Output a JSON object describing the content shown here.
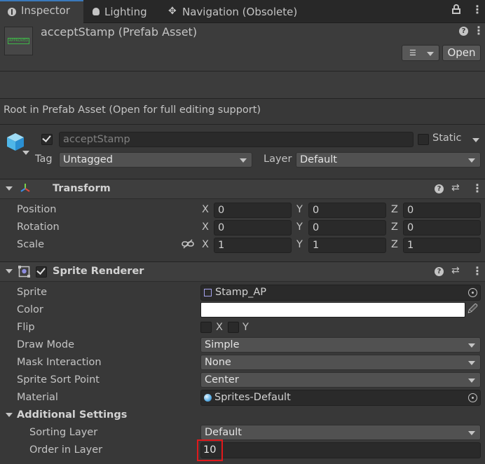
{
  "tabs": [
    {
      "label": "Inspector",
      "icon": "info-icon"
    },
    {
      "label": "Lighting",
      "icon": "bulb-icon"
    },
    {
      "label": "Navigation (Obsolete)",
      "icon": "navigation-icon"
    }
  ],
  "header": {
    "title": "acceptStamp (Prefab Asset)",
    "thumbnail_text": "APPROVED",
    "open_label": "Open"
  },
  "prefab_note": "Root in Prefab Asset (Open for full editing support)",
  "gameobject": {
    "name": "acceptStamp",
    "active": true,
    "static_label": "Static",
    "static": false,
    "tag_label": "Tag",
    "tag_value": "Untagged",
    "layer_label": "Layer",
    "layer_value": "Default"
  },
  "transform": {
    "title": "Transform",
    "rows": [
      {
        "label": "Position",
        "x": "0",
        "y": "0",
        "z": "0"
      },
      {
        "label": "Rotation",
        "x": "0",
        "y": "0",
        "z": "0"
      },
      {
        "label": "Scale",
        "x": "1",
        "y": "1",
        "z": "1"
      }
    ],
    "axis_x": "X",
    "axis_y": "Y",
    "axis_z": "Z"
  },
  "sprite_renderer": {
    "title": "Sprite Renderer",
    "enabled": true,
    "sprite_label": "Sprite",
    "sprite_value": "Stamp_AP",
    "color_label": "Color",
    "color_value": "#ffffff",
    "flip_label": "Flip",
    "flip_x_label": "X",
    "flip_y_label": "Y",
    "draw_mode_label": "Draw Mode",
    "draw_mode_value": "Simple",
    "mask_label": "Mask Interaction",
    "mask_value": "None",
    "sort_point_label": "Sprite Sort Point",
    "sort_point_value": "Center",
    "material_label": "Material",
    "material_value": "Sprites-Default",
    "additional_label": "Additional Settings",
    "sorting_layer_label": "Sorting Layer",
    "sorting_layer_value": "Default",
    "order_label": "Order in Layer",
    "order_value": "10"
  },
  "colors": {
    "highlight": "#e0191c",
    "accent": "#3a79bb"
  }
}
